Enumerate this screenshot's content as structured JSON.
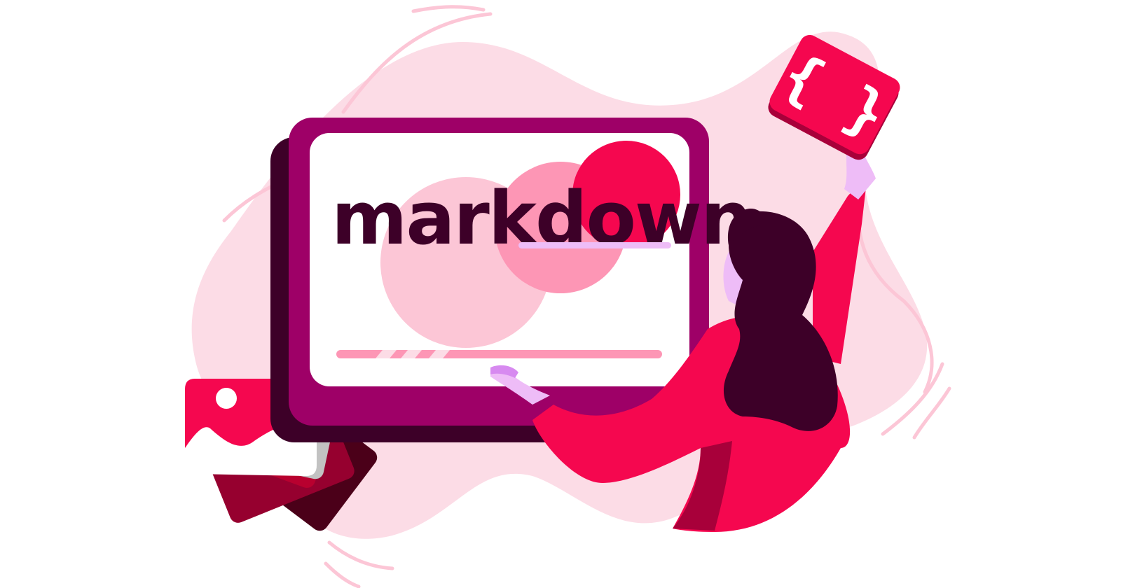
{
  "illustration": {
    "headline": "markdown",
    "badge_symbol": "{ }",
    "icons": {
      "badge": "code-braces-icon",
      "gallery": "image-cards-icon"
    },
    "colors": {
      "background_blob": "#fcdce6",
      "monitor_frame": "#9e0067",
      "monitor_shadow": "#3d0028",
      "screen": "#ffffff",
      "accent": "#f5074f",
      "light_pink": "#fcc6d6",
      "mid_pink": "#fd96b5",
      "text": "#3d0028",
      "skin": "#eebcf7",
      "hair": "#3d0028"
    }
  }
}
